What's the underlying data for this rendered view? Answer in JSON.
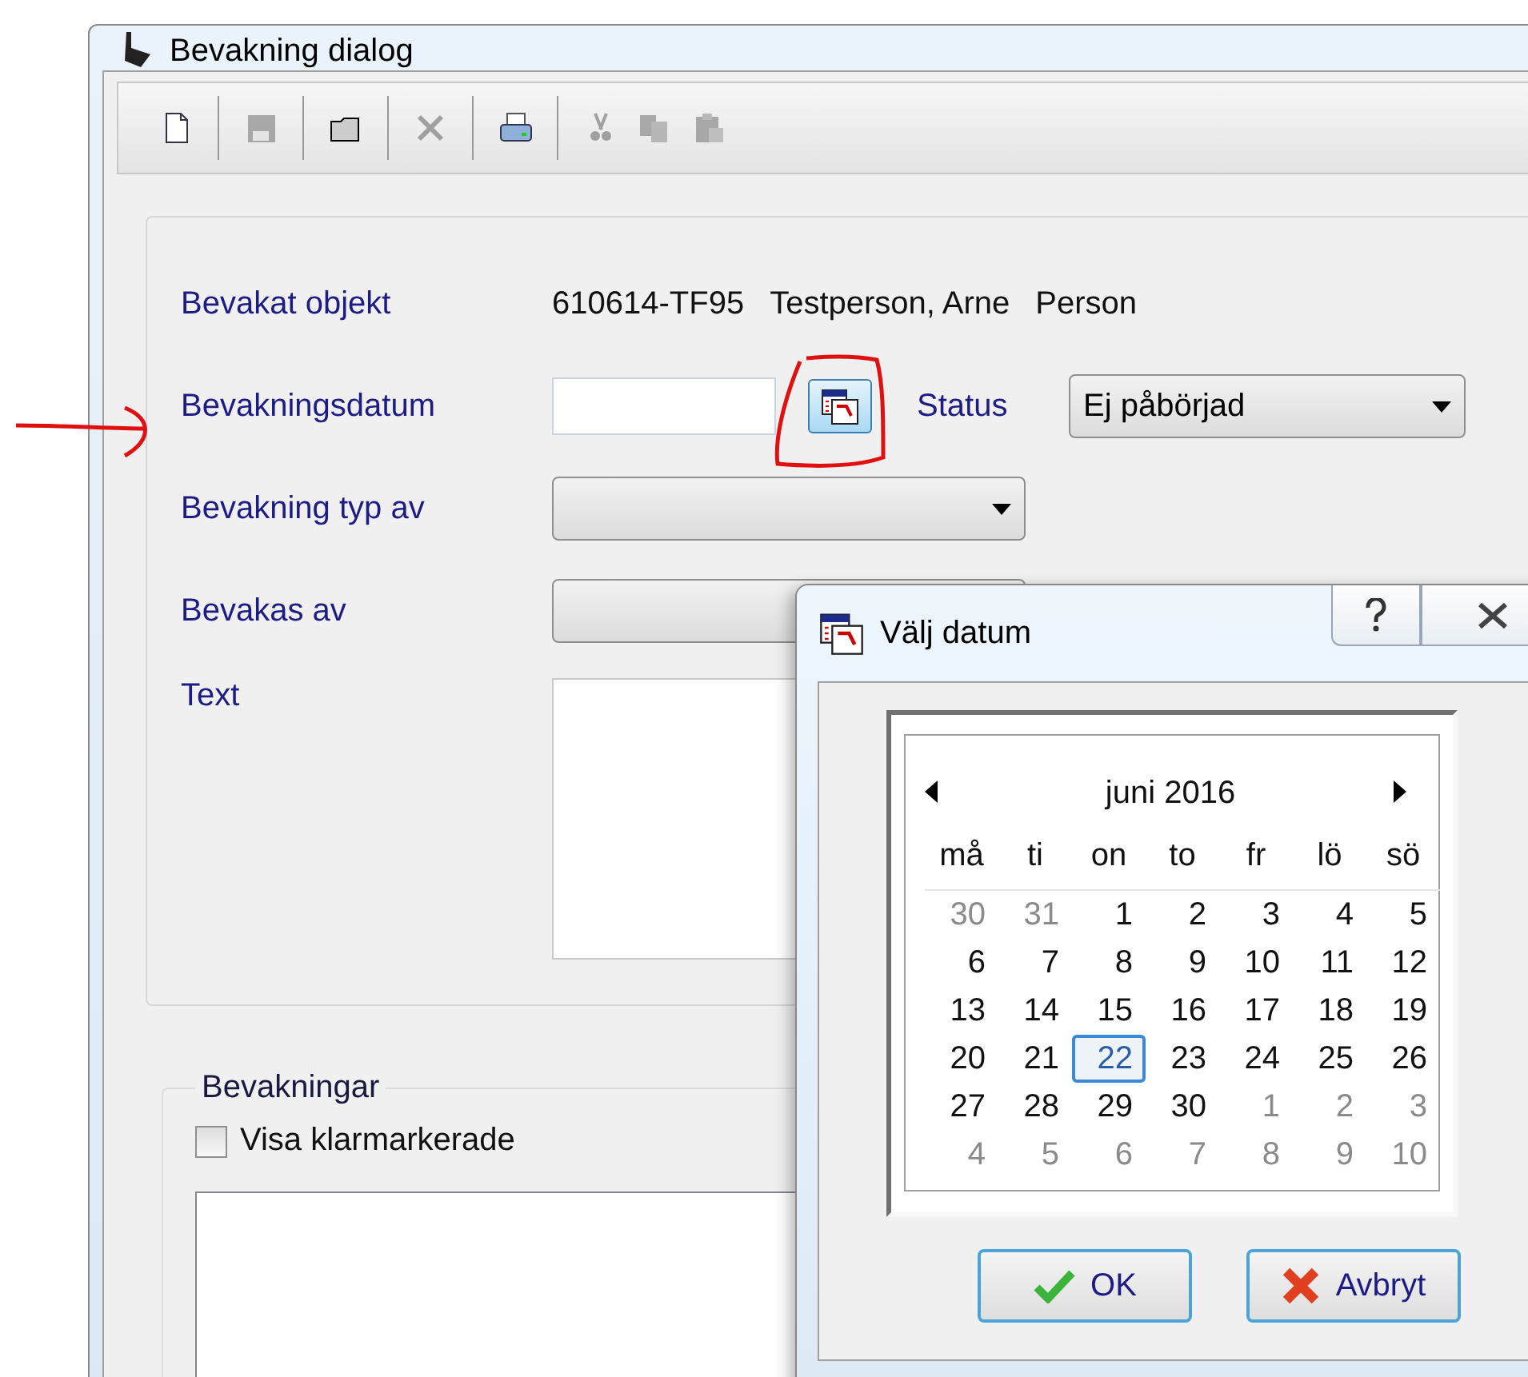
{
  "window": {
    "title": "Bevakning dialog"
  },
  "toolbar": [
    {
      "kind": "new",
      "disabled": false
    },
    {
      "kind": "save",
      "disabled": true
    },
    {
      "kind": "open",
      "disabled": false
    },
    {
      "kind": "delete",
      "disabled": true
    },
    {
      "kind": "print",
      "disabled": false
    },
    {
      "kind": "cut",
      "disabled": true
    },
    {
      "kind": "copy",
      "disabled": true
    },
    {
      "kind": "paste",
      "disabled": true
    }
  ],
  "form": {
    "object_label": "Bevakat objekt",
    "object_id": "610614-TF95",
    "object_name": "Testperson, Arne",
    "object_type": "Person",
    "date_label": "Bevakningsdatum",
    "status_label": "Status",
    "status_value": "Ej påbörjad",
    "type_label": "Bevakning typ av",
    "by_label": "Bevakas av",
    "text_label": "Text"
  },
  "list_group": {
    "title": "Bevakningar",
    "checkbox": {
      "label": "Visa klarmarkerade",
      "checked": false
    }
  },
  "date_dialog": {
    "title": "Välj datum",
    "month": "juni 2016",
    "weekdays": [
      "må",
      "ti",
      "on",
      "to",
      "fr",
      "lö",
      "sö"
    ],
    "days": [
      {
        "label": "30",
        "other_month": true,
        "selected": false
      },
      {
        "label": "31",
        "other_month": true,
        "selected": false
      },
      {
        "label": "1",
        "other_month": false,
        "selected": false
      },
      {
        "label": "2",
        "other_month": false,
        "selected": false
      },
      {
        "label": "3",
        "other_month": false,
        "selected": false
      },
      {
        "label": "4",
        "other_month": false,
        "selected": false
      },
      {
        "label": "5",
        "other_month": false,
        "selected": false
      },
      {
        "label": "6",
        "other_month": false,
        "selected": false
      },
      {
        "label": "7",
        "other_month": false,
        "selected": false
      },
      {
        "label": "8",
        "other_month": false,
        "selected": false
      },
      {
        "label": "9",
        "other_month": false,
        "selected": false
      },
      {
        "label": "10",
        "other_month": false,
        "selected": false
      },
      {
        "label": "11",
        "other_month": false,
        "selected": false
      },
      {
        "label": "12",
        "other_month": false,
        "selected": false
      },
      {
        "label": "13",
        "other_month": false,
        "selected": false
      },
      {
        "label": "14",
        "other_month": false,
        "selected": false
      },
      {
        "label": "15",
        "other_month": false,
        "selected": false
      },
      {
        "label": "16",
        "other_month": false,
        "selected": false
      },
      {
        "label": "17",
        "other_month": false,
        "selected": false
      },
      {
        "label": "18",
        "other_month": false,
        "selected": false
      },
      {
        "label": "19",
        "other_month": false,
        "selected": false
      },
      {
        "label": "20",
        "other_month": false,
        "selected": false
      },
      {
        "label": "21",
        "other_month": false,
        "selected": false
      },
      {
        "label": "22",
        "other_month": false,
        "selected": true
      },
      {
        "label": "23",
        "other_month": false,
        "selected": false
      },
      {
        "label": "24",
        "other_month": false,
        "selected": false
      },
      {
        "label": "25",
        "other_month": false,
        "selected": false
      },
      {
        "label": "26",
        "other_month": false,
        "selected": false
      },
      {
        "label": "27",
        "other_month": false,
        "selected": false
      },
      {
        "label": "28",
        "other_month": false,
        "selected": false
      },
      {
        "label": "29",
        "other_month": false,
        "selected": false
      },
      {
        "label": "30",
        "other_month": false,
        "selected": false
      },
      {
        "label": "1",
        "other_month": true,
        "selected": false
      },
      {
        "label": "2",
        "other_month": true,
        "selected": false
      },
      {
        "label": "3",
        "other_month": true,
        "selected": false
      },
      {
        "label": "4",
        "other_month": true,
        "selected": false
      },
      {
        "label": "5",
        "other_month": true,
        "selected": false
      },
      {
        "label": "6",
        "other_month": true,
        "selected": false
      },
      {
        "label": "7",
        "other_month": true,
        "selected": false
      },
      {
        "label": "8",
        "other_month": true,
        "selected": false
      },
      {
        "label": "9",
        "other_month": true,
        "selected": false
      },
      {
        "label": "10",
        "other_month": true,
        "selected": false
      }
    ],
    "buttons": [
      {
        "kind": "ok",
        "label": "OK"
      },
      {
        "kind": "cancel",
        "label": "Avbryt"
      }
    ]
  }
}
